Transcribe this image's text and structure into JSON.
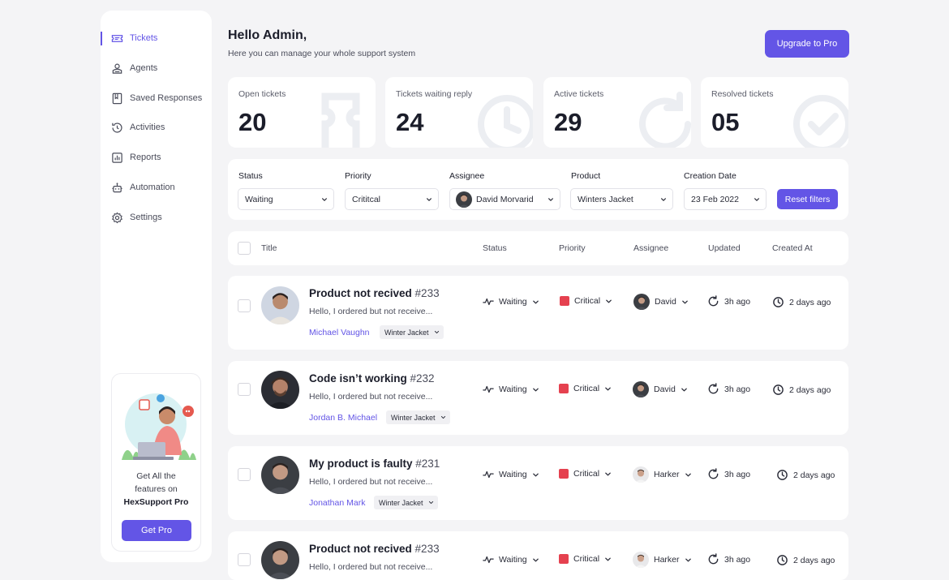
{
  "sidebar": {
    "items": [
      {
        "label": "Tickets",
        "icon": "ticket-icon",
        "active": true
      },
      {
        "label": "Agents",
        "icon": "agent-icon"
      },
      {
        "label": "Saved Responses",
        "icon": "bookmark-icon"
      },
      {
        "label": "Activities",
        "icon": "history-icon"
      },
      {
        "label": "Reports",
        "icon": "chart-icon"
      },
      {
        "label": "Automation",
        "icon": "robot-icon"
      },
      {
        "label": "Settings",
        "icon": "gear-icon"
      }
    ],
    "promo": {
      "line1": "Get All the",
      "line2": "features on",
      "brand": "HexSupport Pro",
      "button": "Get Pro"
    }
  },
  "header": {
    "greeting": "Hello Admin,",
    "subtitle": "Here you can manage your whole support system",
    "upgrade_label": "Upgrade to Pro"
  },
  "stats": [
    {
      "label": "Open tickets",
      "value": "20"
    },
    {
      "label": "Tickets waiting reply",
      "value": "24"
    },
    {
      "label": "Active tickets",
      "value": "29"
    },
    {
      "label": "Resolved tickets",
      "value": "05"
    }
  ],
  "filters": {
    "status": {
      "label": "Status",
      "value": "Waiting"
    },
    "priority": {
      "label": "Priority",
      "value": "Crititcal"
    },
    "assignee": {
      "label": "Assignee",
      "value": "David Morvarid"
    },
    "product": {
      "label": "Product",
      "value": "Winters Jacket"
    },
    "date": {
      "label": "Creation Date",
      "value": "23 Feb 2022"
    },
    "reset_label": "Reset filters"
  },
  "table": {
    "headers": {
      "title": "Title",
      "status": "Status",
      "priority": "Priority",
      "assignee": "Assignee",
      "updated": "Updated",
      "created": "Created At"
    },
    "rows": [
      {
        "title": "Product not recived",
        "num": "#233",
        "desc": "Hello, I ordered but not receive...",
        "customer": "Michael Vaughn",
        "tag": "Winter Jacket",
        "status": "Waiting",
        "priority": "Critical",
        "assignee": "David",
        "updated": "3h ago",
        "created": "2 days ago"
      },
      {
        "title": "Code isn’t working",
        "num": "#232",
        "desc": "Hello, I ordered but not receive...",
        "customer": "Jordan B. Michael",
        "tag": "Winter Jacket",
        "status": "Waiting",
        "priority": "Critical",
        "assignee": "David",
        "updated": "3h ago",
        "created": "2 days ago"
      },
      {
        "title": "My product is faulty",
        "num": "#231",
        "desc": "Hello, I ordered but not receive...",
        "customer": "Jonathan Mark",
        "tag": "Winter Jacket",
        "status": "Waiting",
        "priority": "Critical",
        "assignee": "Harker",
        "updated": "3h ago",
        "created": "2 days ago"
      },
      {
        "title": "Product not recived",
        "num": "#233",
        "desc": "Hello, I ordered but not receive...",
        "customer": "",
        "tag": "",
        "status": "Waiting",
        "priority": "Critical",
        "assignee": "Harker",
        "updated": "3h ago",
        "created": "2 days ago"
      }
    ]
  },
  "colors": {
    "accent": "#6355e6",
    "critical": "#e5414f",
    "background": "#f4f4f6"
  }
}
